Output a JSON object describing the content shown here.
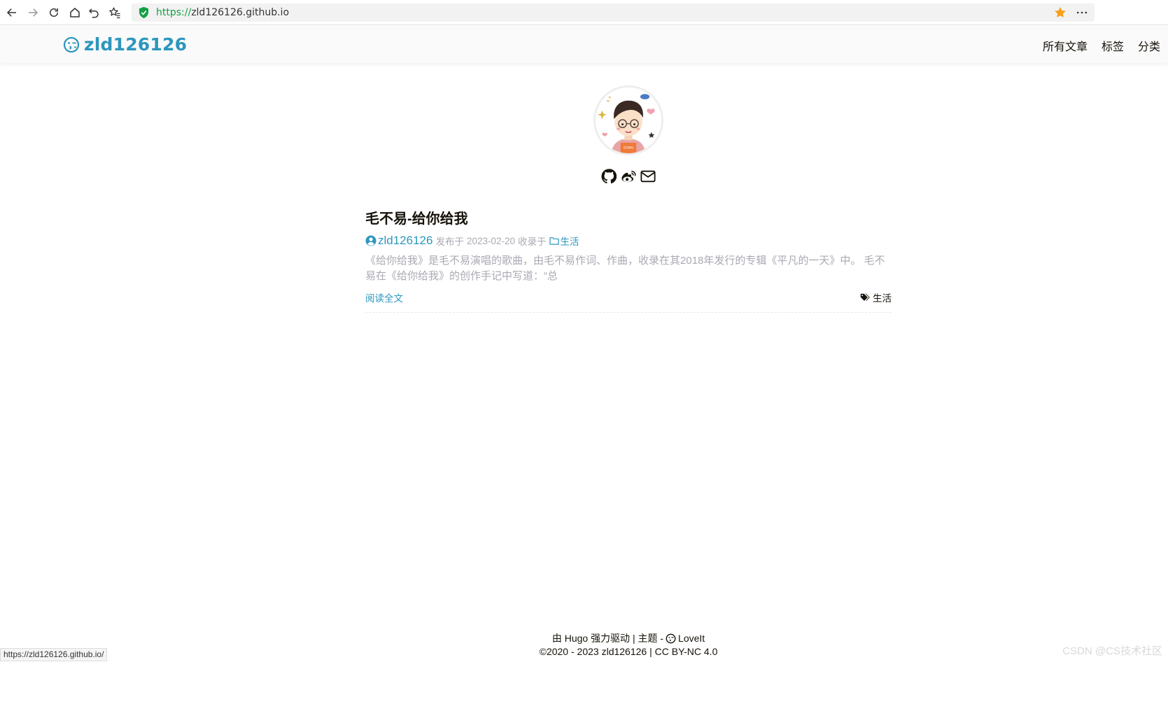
{
  "browser": {
    "url_scheme": "https://",
    "url_host": "zld126126.github.io",
    "status_url": "https://zld126126.github.io/"
  },
  "site": {
    "logo_text": "zld126126",
    "menu": [
      {
        "label": "所有文章"
      },
      {
        "label": "标签"
      },
      {
        "label": "分类"
      }
    ]
  },
  "profile": {
    "social_icons": [
      "github-icon",
      "weibo-icon",
      "email-icon"
    ]
  },
  "post": {
    "title": "毛不易-给你给我",
    "author": "zld126126",
    "published_prefix": "发布于",
    "date": "2023-02-20",
    "category_prefix": "收录于",
    "category": "生活",
    "summary": "《给你给我》是毛不易演唱的歌曲，由毛不易作词、作曲，收录在其2018年发行的专辑《平凡的一天》中。 毛不易在《给你给我》的创作手记中写道：“总",
    "read_more": "阅读全文",
    "tag": "生活"
  },
  "footer": {
    "powered_prefix": "由",
    "powered_by": "Hugo",
    "powered_suffix": "强力驱动 | 主题 -",
    "theme": "LoveIt",
    "copyright_symbol": "©",
    "copyright_years": "2020 - 2023",
    "owner": "zld126126",
    "license_sep": "|",
    "license": "CC BY-NC 4.0"
  },
  "watermark": "CSDN @CS技术社区",
  "colors": {
    "accent": "#2d96bd",
    "secure_green": "#13a045",
    "star_orange": "#f7a21b",
    "muted_text": "#a9a9b3"
  }
}
